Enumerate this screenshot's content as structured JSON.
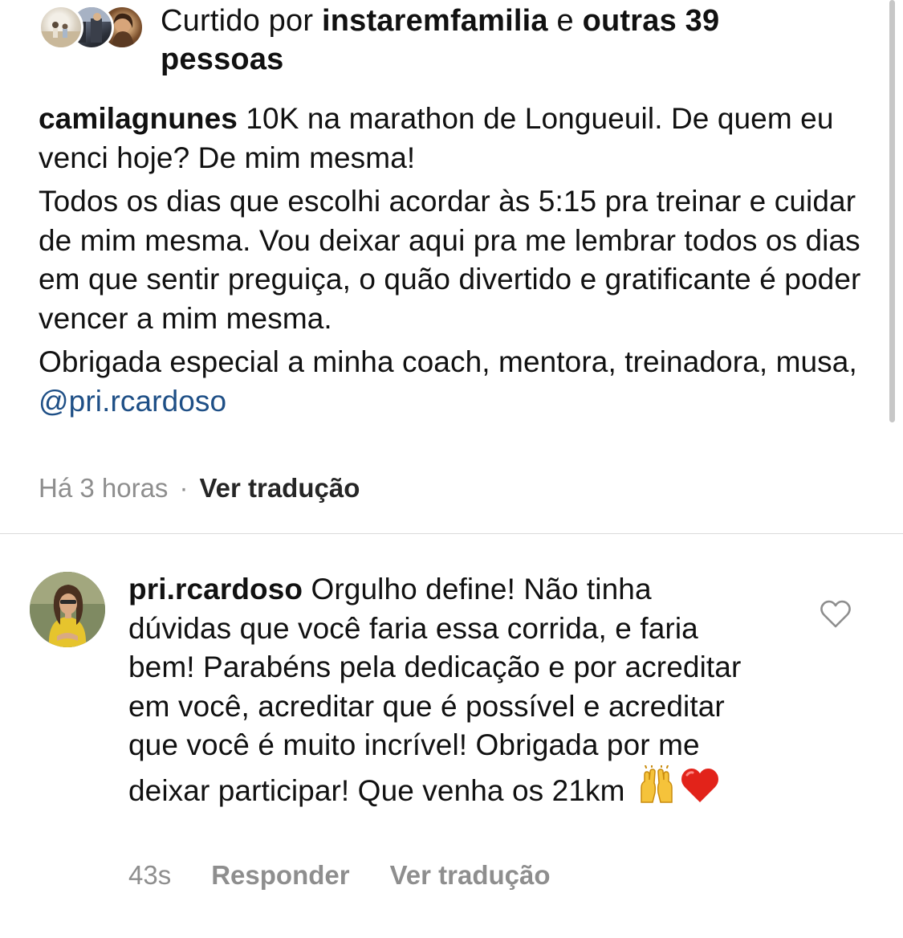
{
  "likes": {
    "prefix": "Curtido por ",
    "user": "instaremfamilia",
    "conjunction": " e ",
    "others": "outras 39 pessoas"
  },
  "caption": {
    "username": "camilagnunes",
    "line1": " 10K na marathon de Longueuil. De quem eu venci hoje? De mim mesma!",
    "paragraph2": "Todos os dias que escolhi acordar às 5:15 pra treinar e cuidar de mim mesma. Vou deixar aqui pra me lembrar todos os dias em que sentir preguiça, o quão divertido e gratificante é poder vencer a mim mesma.",
    "paragraph3": "Obrigada especial a minha coach, mentora, treinadora, musa, ",
    "mention": "@pri.rcardoso",
    "time": "Há 3 horas",
    "separator": "·",
    "translate": "Ver tradução"
  },
  "comment": {
    "username": "pri.rcardoso",
    "text": " Orgulho define! Não tinha dúvidas que você faria essa corrida, e faria bem! Parabéns pela dedicação e por acreditar em você, acreditar que é possível e acreditar que você é muito incrível! Obrigada por me deixar participar! Que venha os 21km ",
    "emojis": [
      "raising-hands-emoji",
      "red-heart-emoji"
    ],
    "age": "43s",
    "reply": "Responder",
    "translate": "Ver tradução",
    "like_icon": "heart-outline-icon"
  },
  "colors": {
    "text": "#111111",
    "secondary": "#8e8e8e",
    "mention": "#1e4f86",
    "divider": "#dbdbdb"
  }
}
